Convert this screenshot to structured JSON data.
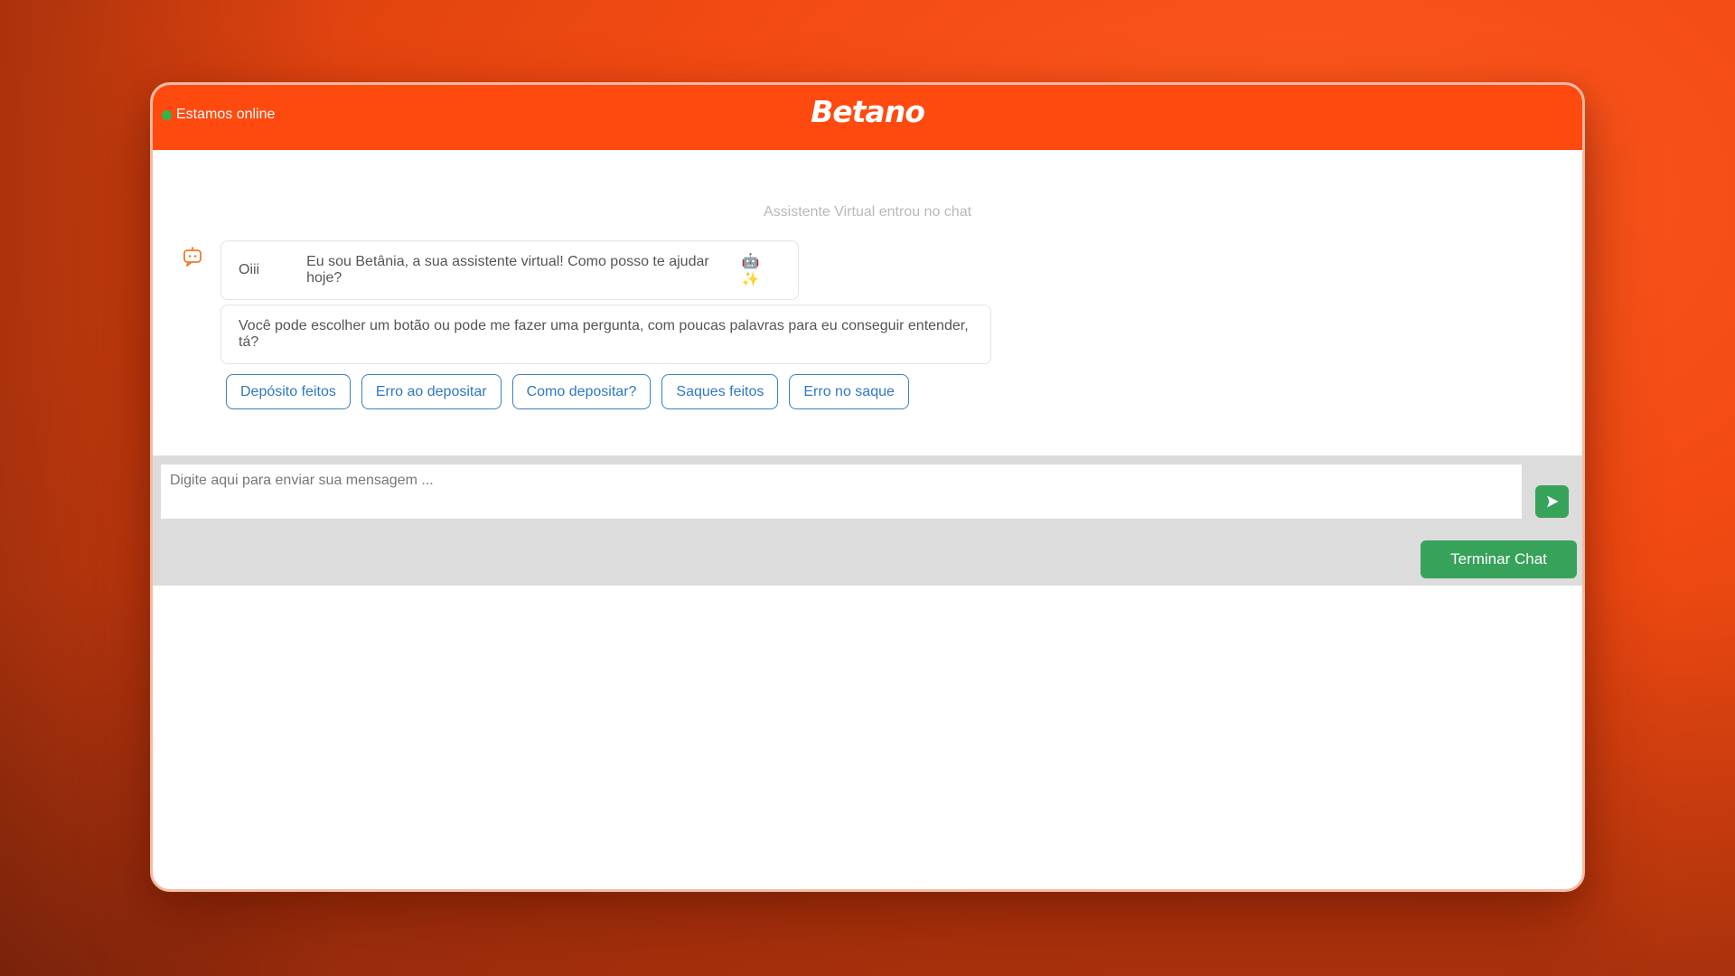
{
  "header": {
    "status_text": "Estamos online",
    "logo_text": "Betano",
    "status_color": "#35b24a",
    "brand_color": "#ff4a0f"
  },
  "chat": {
    "system_message": "Assistente Virtual entrou no chat",
    "bot_icon": "chat-bot-icon",
    "messages": [
      {
        "greeting": "Oiii",
        "text": "Eu sou Betânia, a sua assistente virtual! Como posso te ajudar hoje?",
        "emojis": "🤖 ✨"
      },
      {
        "text": "Você pode escolher um botão ou pode me fazer uma pergunta, com poucas palavras para eu conseguir entender, tá?"
      }
    ],
    "quick_replies": [
      "Depósito feitos",
      "Erro ao depositar",
      "Como depositar?",
      "Saques feitos",
      "Erro no saque"
    ]
  },
  "composer": {
    "placeholder": "Digite aqui para enviar sua mensagem ...",
    "value": "",
    "send_icon": "send-arrow-icon",
    "end_chat_label": "Terminar Chat",
    "action_color": "#37a25a"
  }
}
